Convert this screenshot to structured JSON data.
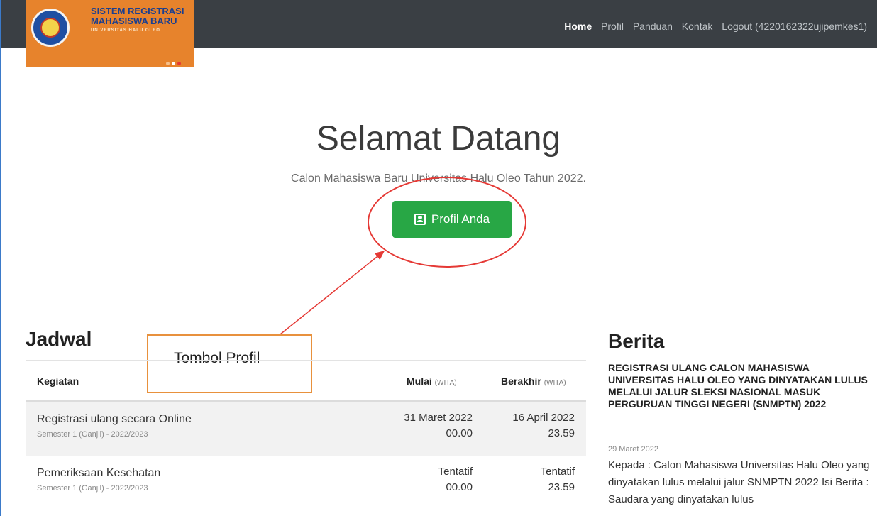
{
  "brand": {
    "line1": "SISTEM REGISTRASI",
    "line2": "MAHASISWA BARU",
    "line3": "UNIVERSITAS HALU OLEO",
    "colors": {
      "logo_bg": "#e7832c",
      "navbar_bg": "#3a3f44"
    }
  },
  "nav": {
    "items": [
      {
        "label": "Home",
        "active": true
      },
      {
        "label": "Profil"
      },
      {
        "label": "Panduan"
      },
      {
        "label": "Kontak"
      },
      {
        "label": "Logout (4220162322ujipemkes1)"
      }
    ]
  },
  "hero": {
    "title": "Selamat Datang",
    "subtitle": "Calon Mahasiswa Baru Universitas Halu Oleo Tahun 2022.",
    "button_label": "Profil Anda",
    "button_icon": "user-card-icon",
    "button_color": "#28a745"
  },
  "annotation": {
    "label": "Tombol Profil",
    "color": "#e53935"
  },
  "jadwal": {
    "title": "Jadwal",
    "headers": {
      "kegiatan": "Kegiatan",
      "mulai": "Mulai",
      "mulai_unit": "(WITA)",
      "berakhir": "Berakhir",
      "berakhir_unit": "(WITA)"
    },
    "rows": [
      {
        "name": "Registrasi ulang secara Online",
        "sub": "Semester 1 (Ganjil) - 2022/2023",
        "mulai_date": "31 Maret 2022",
        "mulai_time": "00.00",
        "akhir_date": "16 April 2022",
        "akhir_time": "23.59"
      },
      {
        "name": "Pemeriksaan Kesehatan",
        "sub": "Semester 1 (Ganjil) - 2022/2023",
        "mulai_date": "Tentatif",
        "mulai_time": "00.00",
        "akhir_date": "Tentatif",
        "akhir_time": "23.59"
      }
    ]
  },
  "berita": {
    "title": "Berita",
    "headline": "REGISTRASI ULANG CALON MAHASISWA UNIVERSITAS HALU OLEO YANG DINYATAKAN LULUS MELALUI JALUR SLEKSI NASIONAL MASUK PERGURUAN TINGGI NEGERI (SNMPTN) 2022",
    "date": "29 Maret 2022",
    "body": "Kepada : Calon Mahasiswa Universitas Halu Oleo yang dinyatakan lulus melalui jalur SNMPTN 2022 Isi Berita : Saudara yang dinyatakan lulus"
  }
}
